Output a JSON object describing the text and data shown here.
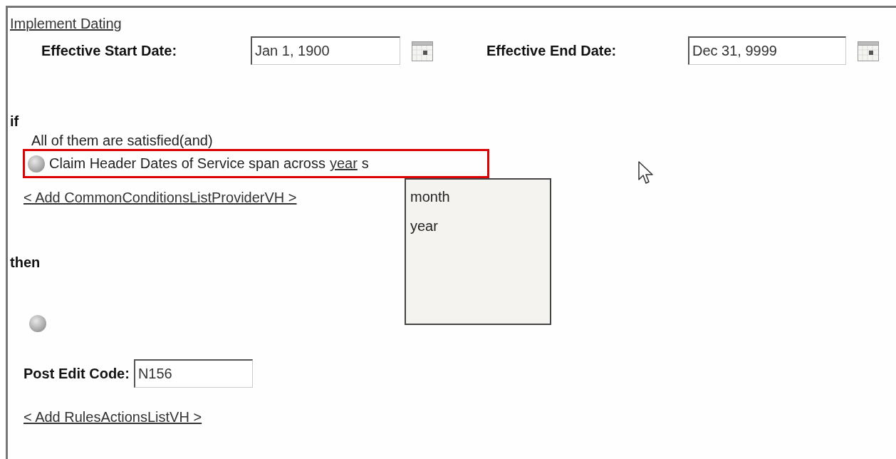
{
  "heading_link": "Implement Dating",
  "dates": [
    {
      "label": "Effective Start Date:",
      "value": "Jan 1, 1900"
    },
    {
      "label": "Effective End Date:",
      "value": "Dec 31, 9999"
    }
  ],
  "if_section": {
    "keyword": "if",
    "group_label": "All of them are satisfied(and)",
    "condition": {
      "text": "Claim Header Dates of Service span across",
      "link": "year",
      "suffix": "s"
    },
    "add_link": "< Add CommonConditionsListProviderVH >"
  },
  "dropdown": {
    "options": [
      {
        "label": "month",
        "selected": false
      },
      {
        "label": "year",
        "selected": false
      }
    ]
  },
  "then_section": {
    "keyword": "then",
    "field": {
      "label": "Post Edit Code:",
      "value": "N156"
    },
    "add_link": "< Add RulesActionsListVH >"
  }
}
